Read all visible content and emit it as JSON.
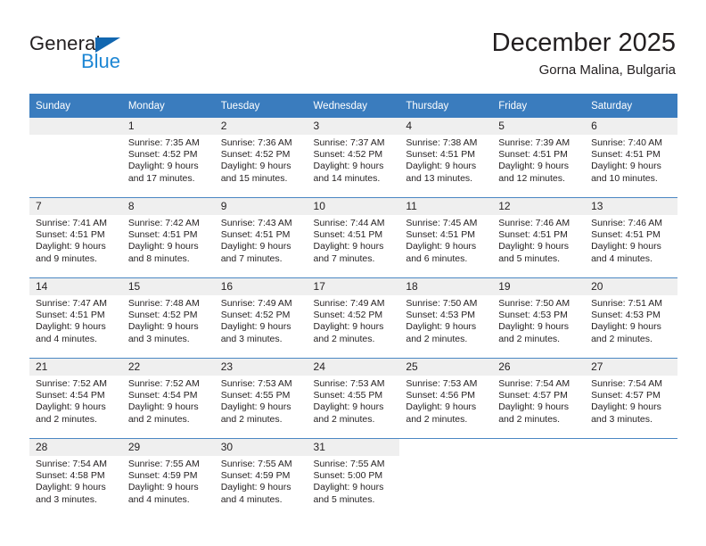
{
  "logo": {
    "word_top": "General",
    "word_bottom": "Blue",
    "triangle_color": "#1267b0",
    "blue_color": "#1c86d4"
  },
  "header": {
    "title": "December 2025",
    "subtitle": "Gorna Malina, Bulgaria"
  },
  "theme": {
    "header_bg": "#3a7cbe",
    "daynum_bg": "#efefef",
    "row_divider": "#4b87c3",
    "text": "#231f20"
  },
  "weekday_headers": [
    "Sunday",
    "Monday",
    "Tuesday",
    "Wednesday",
    "Thursday",
    "Friday",
    "Saturday"
  ],
  "labels": {
    "sunrise_prefix": "Sunrise:",
    "sunset_prefix": "Sunset:",
    "daylight_prefix": "Daylight:"
  },
  "weeks": [
    [
      {
        "day": "",
        "sunrise": "",
        "sunset": "",
        "daylight": "",
        "empty": true
      },
      {
        "day": "1",
        "sunrise": "Sunrise: 7:35 AM",
        "sunset": "Sunset: 4:52 PM",
        "daylight": "Daylight: 9 hours and 17 minutes."
      },
      {
        "day": "2",
        "sunrise": "Sunrise: 7:36 AM",
        "sunset": "Sunset: 4:52 PM",
        "daylight": "Daylight: 9 hours and 15 minutes."
      },
      {
        "day": "3",
        "sunrise": "Sunrise: 7:37 AM",
        "sunset": "Sunset: 4:52 PM",
        "daylight": "Daylight: 9 hours and 14 minutes."
      },
      {
        "day": "4",
        "sunrise": "Sunrise: 7:38 AM",
        "sunset": "Sunset: 4:51 PM",
        "daylight": "Daylight: 9 hours and 13 minutes."
      },
      {
        "day": "5",
        "sunrise": "Sunrise: 7:39 AM",
        "sunset": "Sunset: 4:51 PM",
        "daylight": "Daylight: 9 hours and 12 minutes."
      },
      {
        "day": "6",
        "sunrise": "Sunrise: 7:40 AM",
        "sunset": "Sunset: 4:51 PM",
        "daylight": "Daylight: 9 hours and 10 minutes."
      }
    ],
    [
      {
        "day": "7",
        "sunrise": "Sunrise: 7:41 AM",
        "sunset": "Sunset: 4:51 PM",
        "daylight": "Daylight: 9 hours and 9 minutes."
      },
      {
        "day": "8",
        "sunrise": "Sunrise: 7:42 AM",
        "sunset": "Sunset: 4:51 PM",
        "daylight": "Daylight: 9 hours and 8 minutes."
      },
      {
        "day": "9",
        "sunrise": "Sunrise: 7:43 AM",
        "sunset": "Sunset: 4:51 PM",
        "daylight": "Daylight: 9 hours and 7 minutes."
      },
      {
        "day": "10",
        "sunrise": "Sunrise: 7:44 AM",
        "sunset": "Sunset: 4:51 PM",
        "daylight": "Daylight: 9 hours and 7 minutes."
      },
      {
        "day": "11",
        "sunrise": "Sunrise: 7:45 AM",
        "sunset": "Sunset: 4:51 PM",
        "daylight": "Daylight: 9 hours and 6 minutes."
      },
      {
        "day": "12",
        "sunrise": "Sunrise: 7:46 AM",
        "sunset": "Sunset: 4:51 PM",
        "daylight": "Daylight: 9 hours and 5 minutes."
      },
      {
        "day": "13",
        "sunrise": "Sunrise: 7:46 AM",
        "sunset": "Sunset: 4:51 PM",
        "daylight": "Daylight: 9 hours and 4 minutes."
      }
    ],
    [
      {
        "day": "14",
        "sunrise": "Sunrise: 7:47 AM",
        "sunset": "Sunset: 4:51 PM",
        "daylight": "Daylight: 9 hours and 4 minutes."
      },
      {
        "day": "15",
        "sunrise": "Sunrise: 7:48 AM",
        "sunset": "Sunset: 4:52 PM",
        "daylight": "Daylight: 9 hours and 3 minutes."
      },
      {
        "day": "16",
        "sunrise": "Sunrise: 7:49 AM",
        "sunset": "Sunset: 4:52 PM",
        "daylight": "Daylight: 9 hours and 3 minutes."
      },
      {
        "day": "17",
        "sunrise": "Sunrise: 7:49 AM",
        "sunset": "Sunset: 4:52 PM",
        "daylight": "Daylight: 9 hours and 2 minutes."
      },
      {
        "day": "18",
        "sunrise": "Sunrise: 7:50 AM",
        "sunset": "Sunset: 4:53 PM",
        "daylight": "Daylight: 9 hours and 2 minutes."
      },
      {
        "day": "19",
        "sunrise": "Sunrise: 7:50 AM",
        "sunset": "Sunset: 4:53 PM",
        "daylight": "Daylight: 9 hours and 2 minutes."
      },
      {
        "day": "20",
        "sunrise": "Sunrise: 7:51 AM",
        "sunset": "Sunset: 4:53 PM",
        "daylight": "Daylight: 9 hours and 2 minutes."
      }
    ],
    [
      {
        "day": "21",
        "sunrise": "Sunrise: 7:52 AM",
        "sunset": "Sunset: 4:54 PM",
        "daylight": "Daylight: 9 hours and 2 minutes."
      },
      {
        "day": "22",
        "sunrise": "Sunrise: 7:52 AM",
        "sunset": "Sunset: 4:54 PM",
        "daylight": "Daylight: 9 hours and 2 minutes."
      },
      {
        "day": "23",
        "sunrise": "Sunrise: 7:53 AM",
        "sunset": "Sunset: 4:55 PM",
        "daylight": "Daylight: 9 hours and 2 minutes."
      },
      {
        "day": "24",
        "sunrise": "Sunrise: 7:53 AM",
        "sunset": "Sunset: 4:55 PM",
        "daylight": "Daylight: 9 hours and 2 minutes."
      },
      {
        "day": "25",
        "sunrise": "Sunrise: 7:53 AM",
        "sunset": "Sunset: 4:56 PM",
        "daylight": "Daylight: 9 hours and 2 minutes."
      },
      {
        "day": "26",
        "sunrise": "Sunrise: 7:54 AM",
        "sunset": "Sunset: 4:57 PM",
        "daylight": "Daylight: 9 hours and 2 minutes."
      },
      {
        "day": "27",
        "sunrise": "Sunrise: 7:54 AM",
        "sunset": "Sunset: 4:57 PM",
        "daylight": "Daylight: 9 hours and 3 minutes."
      }
    ],
    [
      {
        "day": "28",
        "sunrise": "Sunrise: 7:54 AM",
        "sunset": "Sunset: 4:58 PM",
        "daylight": "Daylight: 9 hours and 3 minutes."
      },
      {
        "day": "29",
        "sunrise": "Sunrise: 7:55 AM",
        "sunset": "Sunset: 4:59 PM",
        "daylight": "Daylight: 9 hours and 4 minutes."
      },
      {
        "day": "30",
        "sunrise": "Sunrise: 7:55 AM",
        "sunset": "Sunset: 4:59 PM",
        "daylight": "Daylight: 9 hours and 4 minutes."
      },
      {
        "day": "31",
        "sunrise": "Sunrise: 7:55 AM",
        "sunset": "Sunset: 5:00 PM",
        "daylight": "Daylight: 9 hours and 5 minutes."
      },
      {
        "day": "",
        "sunrise": "",
        "sunset": "",
        "daylight": "",
        "empty": true,
        "blank": true
      },
      {
        "day": "",
        "sunrise": "",
        "sunset": "",
        "daylight": "",
        "empty": true,
        "blank": true
      },
      {
        "day": "",
        "sunrise": "",
        "sunset": "",
        "daylight": "",
        "empty": true,
        "blank": true
      }
    ]
  ]
}
